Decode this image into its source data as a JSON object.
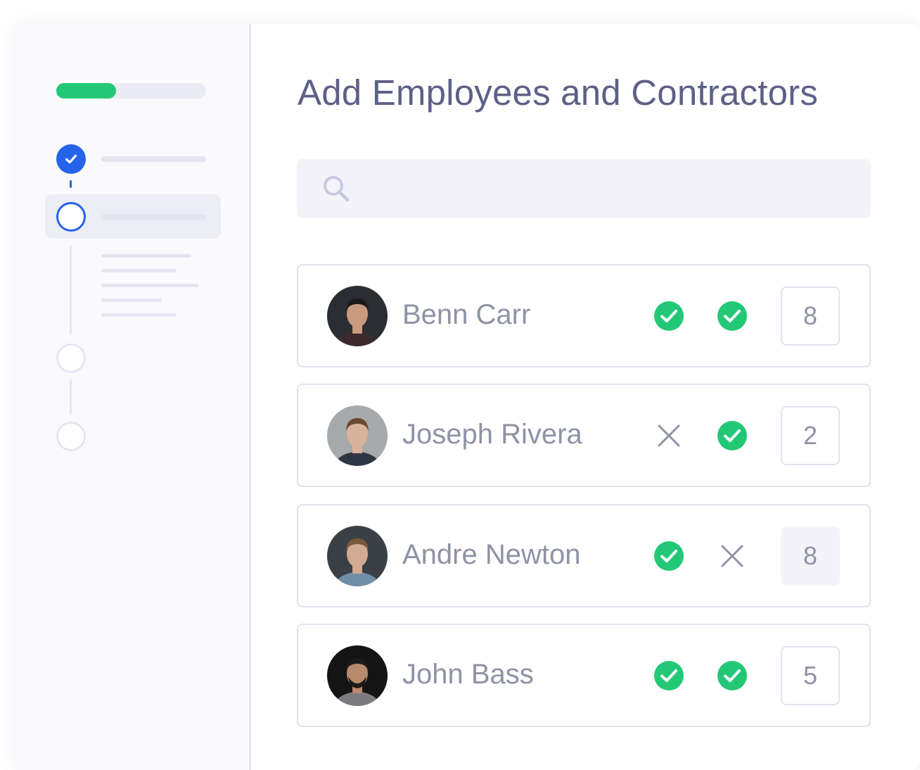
{
  "header": {
    "title": "Add Employees and Contractors"
  },
  "wizard": {
    "progress_fraction": 0.4,
    "steps": [
      {
        "state": "done"
      },
      {
        "state": "current"
      },
      {
        "state": "pending"
      },
      {
        "state": "pending"
      }
    ]
  },
  "search": {
    "icon": "search-icon",
    "placeholder": ""
  },
  "employees": [
    {
      "name": "Benn Carr",
      "status_1": "check",
      "status_2": "check",
      "count": "8",
      "count_style": "outlined"
    },
    {
      "name": "Joseph Rivera",
      "status_1": "cross",
      "status_2": "check",
      "count": "2",
      "count_style": "outlined"
    },
    {
      "name": "Andre Newton",
      "status_1": "check",
      "status_2": "cross",
      "count": "8",
      "count_style": "filled"
    },
    {
      "name": "John Bass",
      "status_1": "check",
      "status_2": "check",
      "count": "5",
      "count_style": "outlined"
    }
  ],
  "colors": {
    "accent_blue": "#2563eb",
    "success_green": "#23c877",
    "title_text": "#5d6187",
    "muted_text": "#8e93a5",
    "border": "#e3e3ef"
  }
}
